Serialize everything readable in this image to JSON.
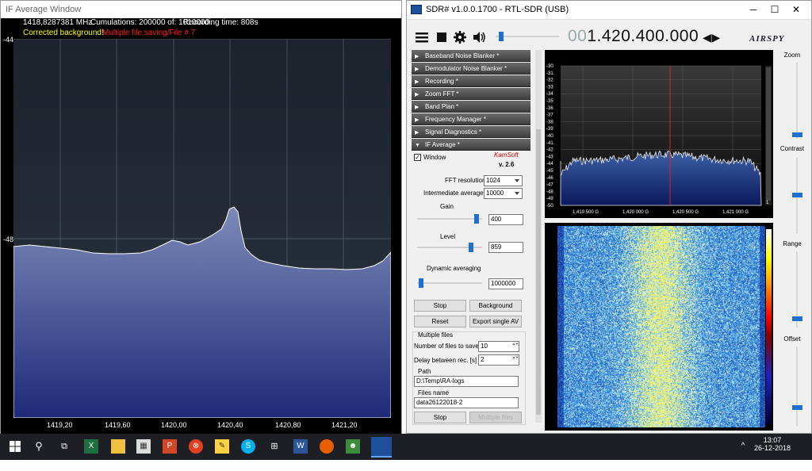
{
  "if_window": {
    "title": "IF Average Window",
    "freq_readout": "1418,8287381 MHz",
    "cumulations": "Cumulations: 200000 of: 1010000",
    "recording_time": "Recording time: 808s",
    "corrected_background": "Corrected background!",
    "multiple_saving": "Multiple file saving/File # 7",
    "y_ticks": [
      "-44",
      "-48"
    ],
    "x_ticks": [
      "1419,20",
      "1419,60",
      "1420,00",
      "1420,40",
      "1420,80",
      "1421,20"
    ],
    "colors": {
      "fill": "#6677aa",
      "bg": "#000000",
      "grid": "#6a6a6a"
    }
  },
  "sdr": {
    "title": "SDR# v1.0.0.1700 - RTL-SDR (USB)",
    "freq_dim": "00",
    "freq_main": "1.420.400.000",
    "logo": "AIRSPY",
    "plugins": [
      "Baseband Noise Blanker *",
      "Demodulator Noise Blanker *",
      "Recording *",
      "Zoom FFT *",
      "Band Plan *",
      "Frequency Manager *",
      "Signal Diagnostics *",
      "IF Average *"
    ],
    "if_average": {
      "window_label": "Window",
      "author": "KamSoft",
      "version": "v. 2.6",
      "fft_resolution_label": "FFT resolution",
      "fft_resolution": "1024",
      "intermediate_average_label": "Intermediate average",
      "intermediate_average": "10000",
      "gain_label": "Gain",
      "gain": "400",
      "gain_level": 0.95,
      "level_label": "Level",
      "level": "859",
      "level_level": 0.86,
      "dyn_label": "Dynamic averaging",
      "dyn": "1000000",
      "dyn_level": 0.02,
      "stop_label": "Stop",
      "background_label": "Background",
      "reset_label": "Reset",
      "export_label": "Export single AV",
      "multiple_files_label": "Multiple files",
      "num_files_label": "Number of files to save",
      "num_files": "10",
      "delay_label": "Delay between rec. [s]",
      "delay": "2",
      "path_label": "Path",
      "path": "D:\\Temp\\RA-logs",
      "files_name_label": "Files name",
      "files_name": "data26122018-2",
      "stop2_label": "Stop",
      "multiple_files_btn": "Multiple files"
    },
    "spectrum": {
      "y_ticks": [
        "-30",
        "-31",
        "-32",
        "-33",
        "-34",
        "-35",
        "-36",
        "-37",
        "-38",
        "-39",
        "-40",
        "-41",
        "-42",
        "-43",
        "-44",
        "-45",
        "-46",
        "-47",
        "-48",
        "-49",
        "-50"
      ],
      "x_ticks": [
        "1,419 500 G",
        "1,420 000 G",
        "1,420 500 G",
        "1,421 000 G"
      ],
      "scroll_value": "1"
    },
    "right_controls": {
      "zoom_label": "Zoom",
      "contrast_label": "Contrast",
      "range_label": "Range",
      "offset_label": "Offset"
    }
  },
  "taskbar": {
    "time": "13:07",
    "date": "26-12-2018"
  }
}
